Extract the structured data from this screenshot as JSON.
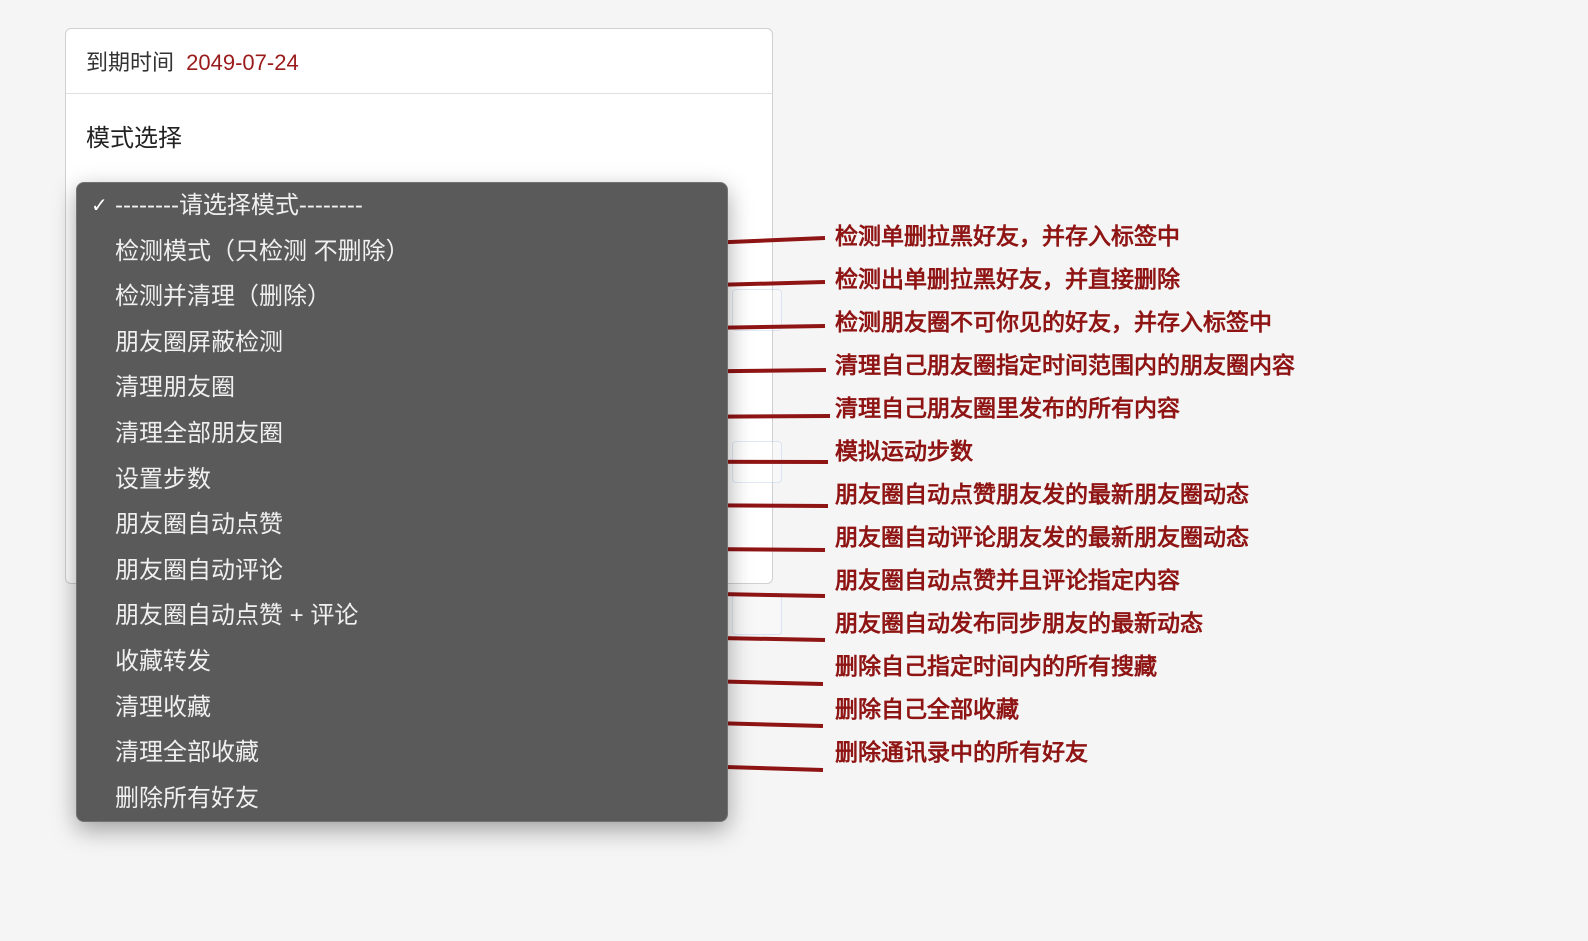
{
  "expiry": {
    "label": "到期时间",
    "date": "2049-07-24"
  },
  "mode": {
    "section_label": "模式选择"
  },
  "dropdown": {
    "placeholder": "--------请选择模式--------",
    "items": [
      {
        "label": "检测模式（只检测 不删除）"
      },
      {
        "label": "检测并清理（删除）"
      },
      {
        "label": "朋友圈屏蔽检测"
      },
      {
        "label": "清理朋友圈"
      },
      {
        "label": "清理全部朋友圈"
      },
      {
        "label": "设置步数"
      },
      {
        "label": "朋友圈自动点赞"
      },
      {
        "label": "朋友圈自动评论"
      },
      {
        "label": "朋友圈自动点赞 + 评论"
      },
      {
        "label": "收藏转发"
      },
      {
        "label": "清理收藏"
      },
      {
        "label": "清理全部收藏"
      },
      {
        "label": "删除所有好友"
      }
    ]
  },
  "annotations": [
    "检测单删拉黑好友，并存入标签中",
    "检测出单删拉黑好友，并直接删除",
    "检测朋友圈不可你见的好友，并存入标签中",
    "清理自己朋友圈指定时间范围内的朋友圈内容",
    "清理自己朋友圈里发布的所有内容",
    "模拟运动步数",
    "朋友圈自动点赞朋友发的最新朋友圈动态",
    "朋友圈自动评论朋友发的最新朋友圈动态",
    "朋友圈自动点赞并且评论指定内容",
    "朋友圈自动发布同步朋友的最新动态",
    "删除自己指定时间内的所有搜藏",
    "删除自己全部收藏",
    "删除通讯录中的所有好友"
  ],
  "colors": {
    "annotation": "#8f1414",
    "expiry_date": "#9a1b1b",
    "dropdown_bg": "#5a5a5a"
  }
}
